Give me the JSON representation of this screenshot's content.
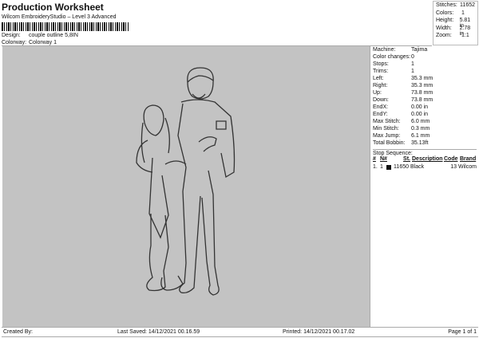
{
  "header": {
    "title": "Production Worksheet",
    "subtitle": "Wilcom EmbroideryStudio – Level 3 Advanced",
    "design_label": "Design:",
    "design": "couple outline 5,8IN",
    "colorway_label": "Colorway:",
    "colorway": "Colorway 1"
  },
  "stats": [
    {
      "k": "Stitches:",
      "v": "11652"
    },
    {
      "k": "Colors:",
      "v": "1"
    },
    {
      "k": "Height:",
      "v": "5.81 in"
    },
    {
      "k": "Width:",
      "v": "2.78 in"
    },
    {
      "k": "Zoom:",
      "v": "1:1"
    }
  ],
  "details": [
    {
      "k": "Machine:",
      "v": "Tajima"
    },
    {
      "k": "Color changes:",
      "v": "0"
    },
    {
      "k": "Stops:",
      "v": "1"
    },
    {
      "k": "Trims:",
      "v": "1"
    },
    {
      "k": "Left:",
      "v": "35.3 mm"
    },
    {
      "k": "Right:",
      "v": "35.3 mm"
    },
    {
      "k": "Up:",
      "v": "73.8 mm"
    },
    {
      "k": "Down:",
      "v": "73.8 mm"
    },
    {
      "k": "EndX:",
      "v": "0.00 in"
    },
    {
      "k": "EndY:",
      "v": "0.00 in"
    },
    {
      "k": "Max Stitch:",
      "v": "6.0 mm"
    },
    {
      "k": "Min Stitch:",
      "v": "0.3 mm"
    },
    {
      "k": "Max Jump:",
      "v": "6.1 mm"
    },
    {
      "k": "Total Bobbin:",
      "v": "35.13ft"
    }
  ],
  "stop_sequence": {
    "label": "Stop Sequence:",
    "headers": [
      "#",
      "N#",
      "St.",
      "Description",
      "Code",
      "Brand"
    ],
    "rows": [
      {
        "num": "1.",
        "n": "1",
        "st": "11650",
        "desc": "Black",
        "code": "13",
        "brand": "Wilcom",
        "color": "#111111"
      }
    ]
  },
  "footer": {
    "created": "Created By:",
    "saved": "Last Saved: 14/12/2021 00.16.59",
    "printed": "Printed: 14/12/2021 00.17.02",
    "page": "Page 1 of 1"
  }
}
